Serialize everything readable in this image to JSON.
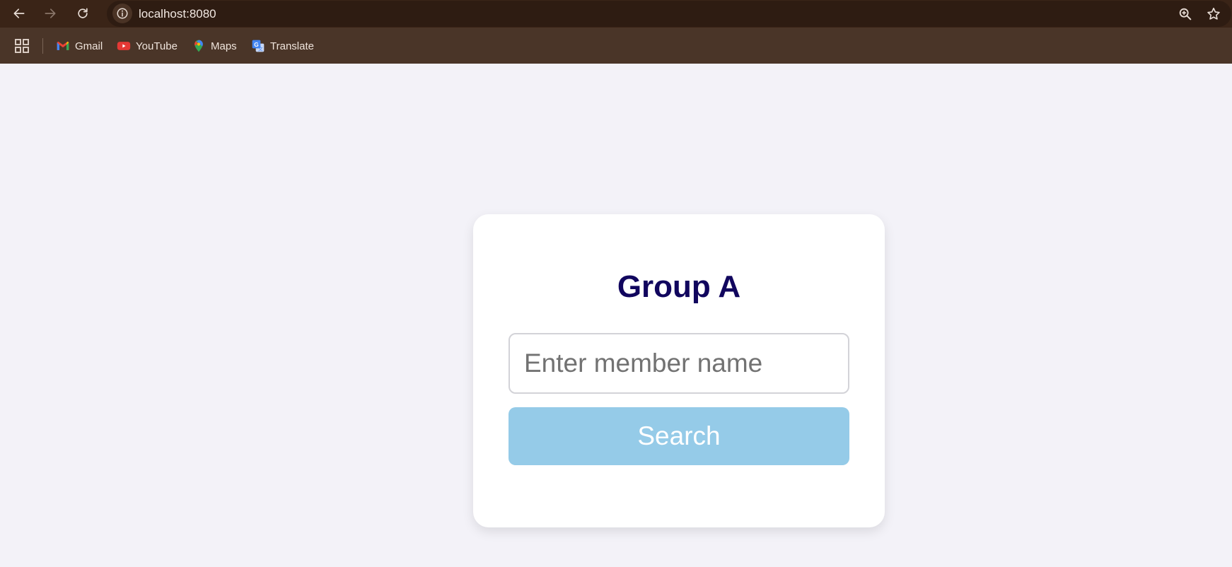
{
  "browser": {
    "url": "localhost:8080",
    "bookmarks": [
      {
        "label": "Gmail",
        "icon": "gmail-icon"
      },
      {
        "label": "YouTube",
        "icon": "youtube-icon"
      },
      {
        "label": "Maps",
        "icon": "maps-icon"
      },
      {
        "label": "Translate",
        "icon": "translate-icon"
      }
    ],
    "colors": {
      "toolbar": "#3a2417",
      "bookmarks_bar": "#4a3528"
    }
  },
  "page": {
    "title": "Group A",
    "search": {
      "placeholder": "Enter member name",
      "value": ""
    },
    "search_button_label": "Search",
    "colors": {
      "title": "#11065e",
      "button": "#95cbe8",
      "background": "#f3f2f8"
    }
  }
}
